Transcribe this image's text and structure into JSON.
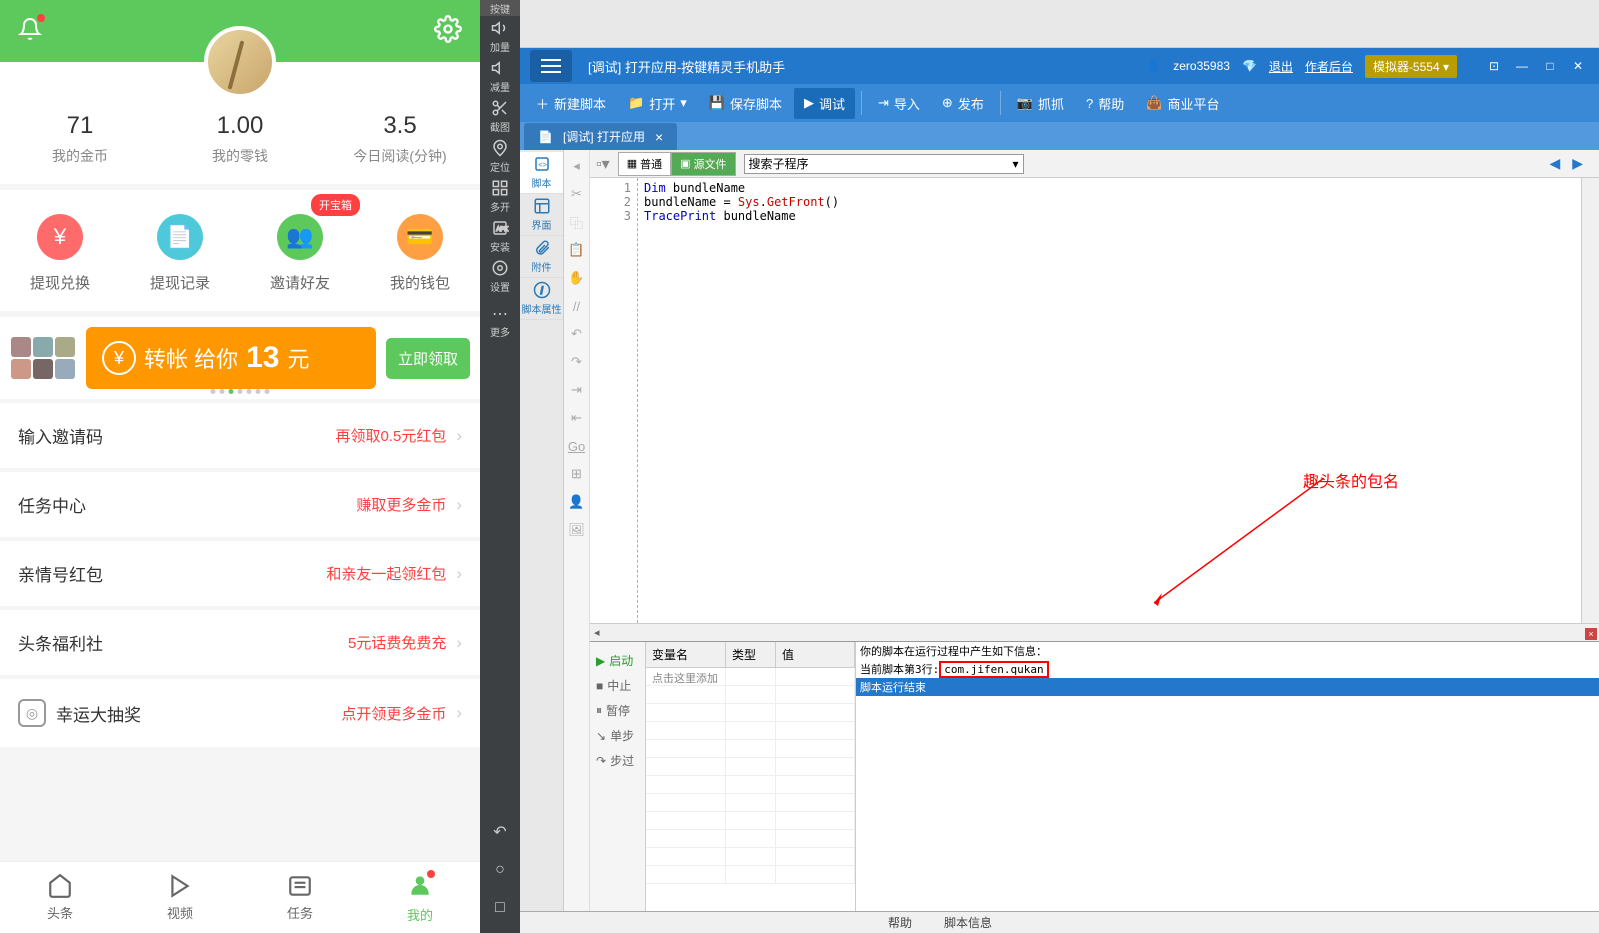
{
  "phone": {
    "stats": [
      {
        "value": "71",
        "label": "我的金币"
      },
      {
        "value": "1.00",
        "label": "我的零钱"
      },
      {
        "value": "3.5",
        "label": "今日阅读(分钟)"
      }
    ],
    "treasure_badge": "开宝箱",
    "actions": [
      {
        "label": "提现兑换"
      },
      {
        "label": "提现记录"
      },
      {
        "label": "邀请好友"
      },
      {
        "label": "我的钱包"
      }
    ],
    "banner_text_1": "转帐 给你",
    "banner_text_2": "13",
    "banner_text_3": "元",
    "banner_btn": "立即领取",
    "list": [
      {
        "title": "输入邀请码",
        "sub": "再领取0.5元红包"
      },
      {
        "title": "任务中心",
        "sub": "赚取更多金币"
      },
      {
        "title": "亲情号红包",
        "sub": "和亲友一起领红包"
      },
      {
        "title": "头条福利社",
        "sub": "5元话费免费充"
      },
      {
        "title": "幸运大抽奖",
        "sub": "点开领更多金币"
      }
    ],
    "tabs": [
      {
        "label": "头条"
      },
      {
        "label": "视频"
      },
      {
        "label": "任务"
      },
      {
        "label": "我的"
      }
    ]
  },
  "dev_sidebar": {
    "top_tab": "按键",
    "items": [
      "加量",
      "减量",
      "截图",
      "定位",
      "多开",
      "安装",
      "设置"
    ],
    "more": "更多"
  },
  "ide": {
    "title": "[调试] 打开应用-按键精灵手机助手",
    "user": "zero35983",
    "logout": "退出",
    "author": "作者后台",
    "simulator": "模拟器-5554",
    "toolbar": [
      {
        "label": "新建脚本",
        "icon": "plus"
      },
      {
        "label": "打开",
        "icon": "folder"
      },
      {
        "label": "保存脚本",
        "icon": "save"
      },
      {
        "label": "调试",
        "icon": "play",
        "active": true
      },
      {
        "label": "导入",
        "icon": "import"
      },
      {
        "label": "发布",
        "icon": "upload"
      },
      {
        "label": "抓抓",
        "icon": "camera"
      },
      {
        "label": "帮助",
        "icon": "help"
      },
      {
        "label": "商业平台",
        "icon": "bag"
      }
    ],
    "tab": "[调试] 打开应用",
    "left_tabs": [
      "脚本",
      "界面",
      "附件",
      "脚本属性"
    ],
    "code_toolbar": {
      "mode_normal": "普通",
      "mode_source": "源文件",
      "search_placeholder": "搜索子程序"
    },
    "code_lines": [
      {
        "n": 1,
        "tokens": [
          [
            "kw",
            "Dim"
          ],
          [
            "",
            " bundleName"
          ]
        ]
      },
      {
        "n": 2,
        "tokens": [
          [
            "",
            "bundleName = "
          ],
          [
            "fn",
            "Sys"
          ],
          [
            "",
            "."
          ],
          [
            "fn",
            "GetFront"
          ],
          [
            "",
            "()"
          ]
        ]
      },
      {
        "n": 3,
        "tokens": [
          [
            "kw",
            "TracePrint"
          ],
          [
            "",
            " bundleName"
          ]
        ]
      }
    ],
    "annotation": "趣头条的包名",
    "debug": {
      "controls": [
        "启动",
        "中止",
        "暂停",
        "单步",
        "步过"
      ],
      "var_headers": [
        "变量名",
        "类型",
        "值"
      ],
      "var_placeholder": "点击这里添加",
      "output_line1": "你的脚本在运行过程中产生如下信息：",
      "output_line2_prefix": "当前脚本第3行:",
      "output_line2_box": "com.jifen.qukan",
      "output_line3": "脚本运行结束"
    },
    "statusbar": [
      "帮助",
      "脚本信息"
    ]
  }
}
